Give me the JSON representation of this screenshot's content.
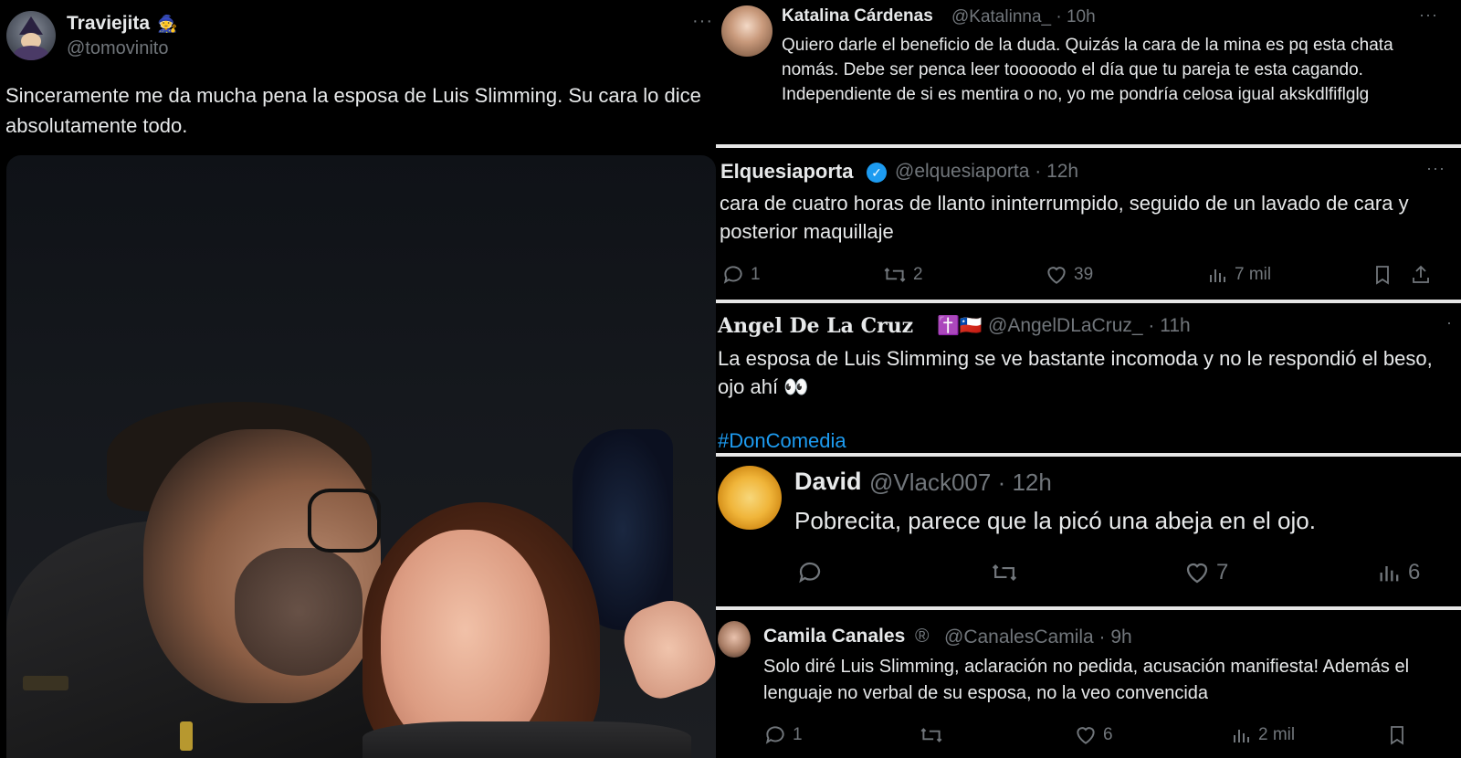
{
  "main_tweet": {
    "name": "Traviejita",
    "name_emoji": "🧙",
    "handle": "@tomovinito",
    "more": "···",
    "text": "Sinceramente me da mucha pena la esposa de Luis Slimming. Su cara lo dice absolutamente todo."
  },
  "replies": [
    {
      "name": "Katalina Cárdenas",
      "meta": "@Katalinna_ · 10h",
      "more": "···",
      "text": "Quiero darle el beneficio de la duda. Quizás la cara de la mina es pq esta chata nomás. Debe ser penca leer tooooodo el día que tu pareja te esta cagando. Independiente de si es mentira o no, yo me pondría celosa igual akskdlfiflglg"
    },
    {
      "name": "Elquesiaporta",
      "verified": "✓",
      "meta": "@elquesiaporta · 12h",
      "more": "···",
      "text": "cara de cuatro horas de llanto ininterrumpido, seguido de un lavado de cara y posterior maquillaje",
      "replies": "1",
      "retweets": "2",
      "likes": "39",
      "views": "7 mil"
    },
    {
      "name": "Angel De La Cruz",
      "name_emojis": "✝️🇨🇱",
      "meta": "@AngelDLaCruz_ · 11h",
      "more": "·",
      "text": "La esposa de Luis Slimming se ve bastante incomoda y no le respondió el beso, ojo ahí 👀",
      "hashtag": "#DonComedia"
    },
    {
      "name": "David",
      "meta": "@Vlack007 · 12h",
      "text": "Pobrecita, parece que la picó una abeja en el ojo.",
      "likes": "7",
      "views": "6"
    },
    {
      "name": "Camila Canales",
      "name_badge": "®",
      "meta": "@CanalesCamila · 9h",
      "text": "Solo diré Luis Slimming, aclaración no pedida, acusación manifiesta! Además el lenguaje no verbal de su esposa, no la veo convencida",
      "replies": "1",
      "likes": "6",
      "views": "2 mil"
    }
  ]
}
